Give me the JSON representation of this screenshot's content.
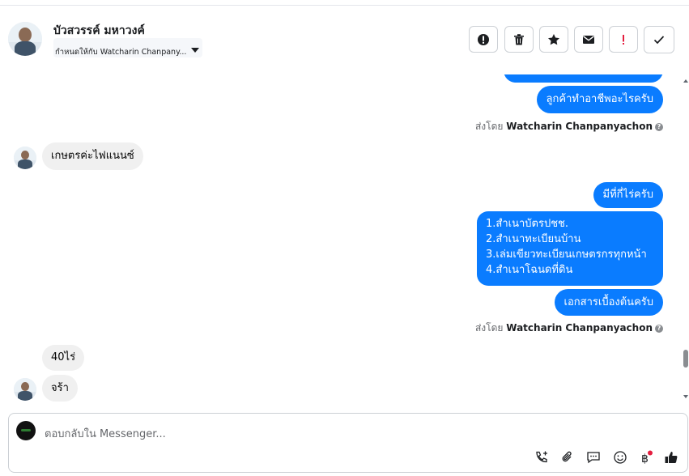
{
  "header": {
    "contact_name": "บัวสวรรค์ มหาวงค์",
    "assigned_label": "กำหนดให้กับ Watcharin Chanpany..."
  },
  "actions": [
    {
      "name": "mark-spam-button",
      "icon": "exclamation-circle-icon"
    },
    {
      "name": "delete-button",
      "icon": "trash-icon"
    },
    {
      "name": "star-button",
      "icon": "star-icon"
    },
    {
      "name": "mark-unread-button",
      "icon": "envelope-icon"
    },
    {
      "name": "follow-up-button",
      "icon": "exclamation-icon",
      "color": "#e41e3f"
    },
    {
      "name": "mark-done-button",
      "icon": "check-icon"
    }
  ],
  "thread": {
    "msg_partial": "",
    "msg_occupation_question": "ลูกค้าทำอาชีพอะไรครับ",
    "sent_by_1_prefix": "ส่งโดย",
    "sent_by_1_name": "Watcharin Chanpanyachon",
    "msg_in_farmer": "เกษตรค่ะไฟแนนซ์",
    "msg_land_question": "มีที่กี่ไร่ครับ",
    "msg_documents": [
      "1.สำเนาบัตรปชช.",
      "2.สำเนาทะเบียนบ้าน",
      "3.เล่มเขียวทะเบียนเกษตรกรทุกหน้า",
      "4.สำเนาโฉนดที่ดิน"
    ],
    "msg_basic_docs": "เอกสารเบื้องต้นครับ",
    "sent_by_2_prefix": "ส่งโดย",
    "sent_by_2_name": "Watcharin Chanpanyachon",
    "msg_in_40rai": "40ไร่",
    "msg_in_ok": "จร้า"
  },
  "composer": {
    "placeholder": "ตอบกลับใน Messenger...",
    "tools": [
      "call-add-icon",
      "paperclip-icon",
      "saved-reply-icon",
      "emoji-icon",
      "baht-payment-icon",
      "thumbs-up-icon"
    ]
  },
  "colors": {
    "outgoing_bubble": "#0a7cff",
    "incoming_bubble": "#f0f0f0",
    "notification_dot": "#e41e3f"
  }
}
